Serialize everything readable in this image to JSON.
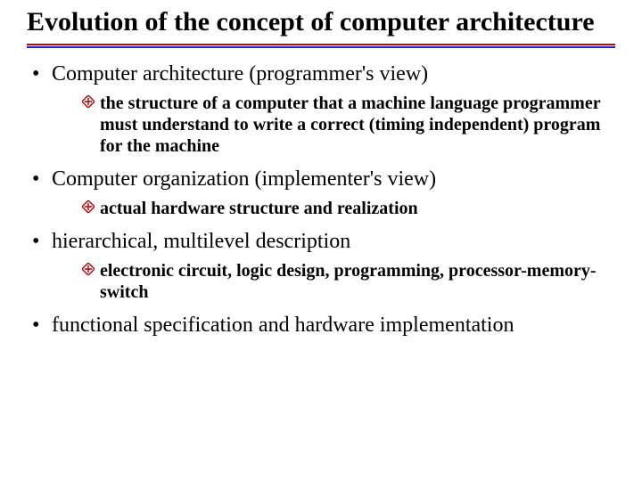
{
  "title": "Evolution of the concept of computer architecture",
  "bullets": [
    {
      "text": "Computer architecture (programmer's view)",
      "sub": [
        "the structure of a computer that a machine language programmer must understand to write a correct (timing independent) program for the machine"
      ]
    },
    {
      "text": "Computer organization (implementer's view)",
      "sub": [
        "actual hardware structure and realization"
      ]
    },
    {
      "text": "hierarchical, multilevel description",
      "sub": [
        "electronic circuit, logic design, programming, processor-memory-switch"
      ]
    },
    {
      "text": "functional specification and hardware implementation",
      "sub": []
    }
  ]
}
